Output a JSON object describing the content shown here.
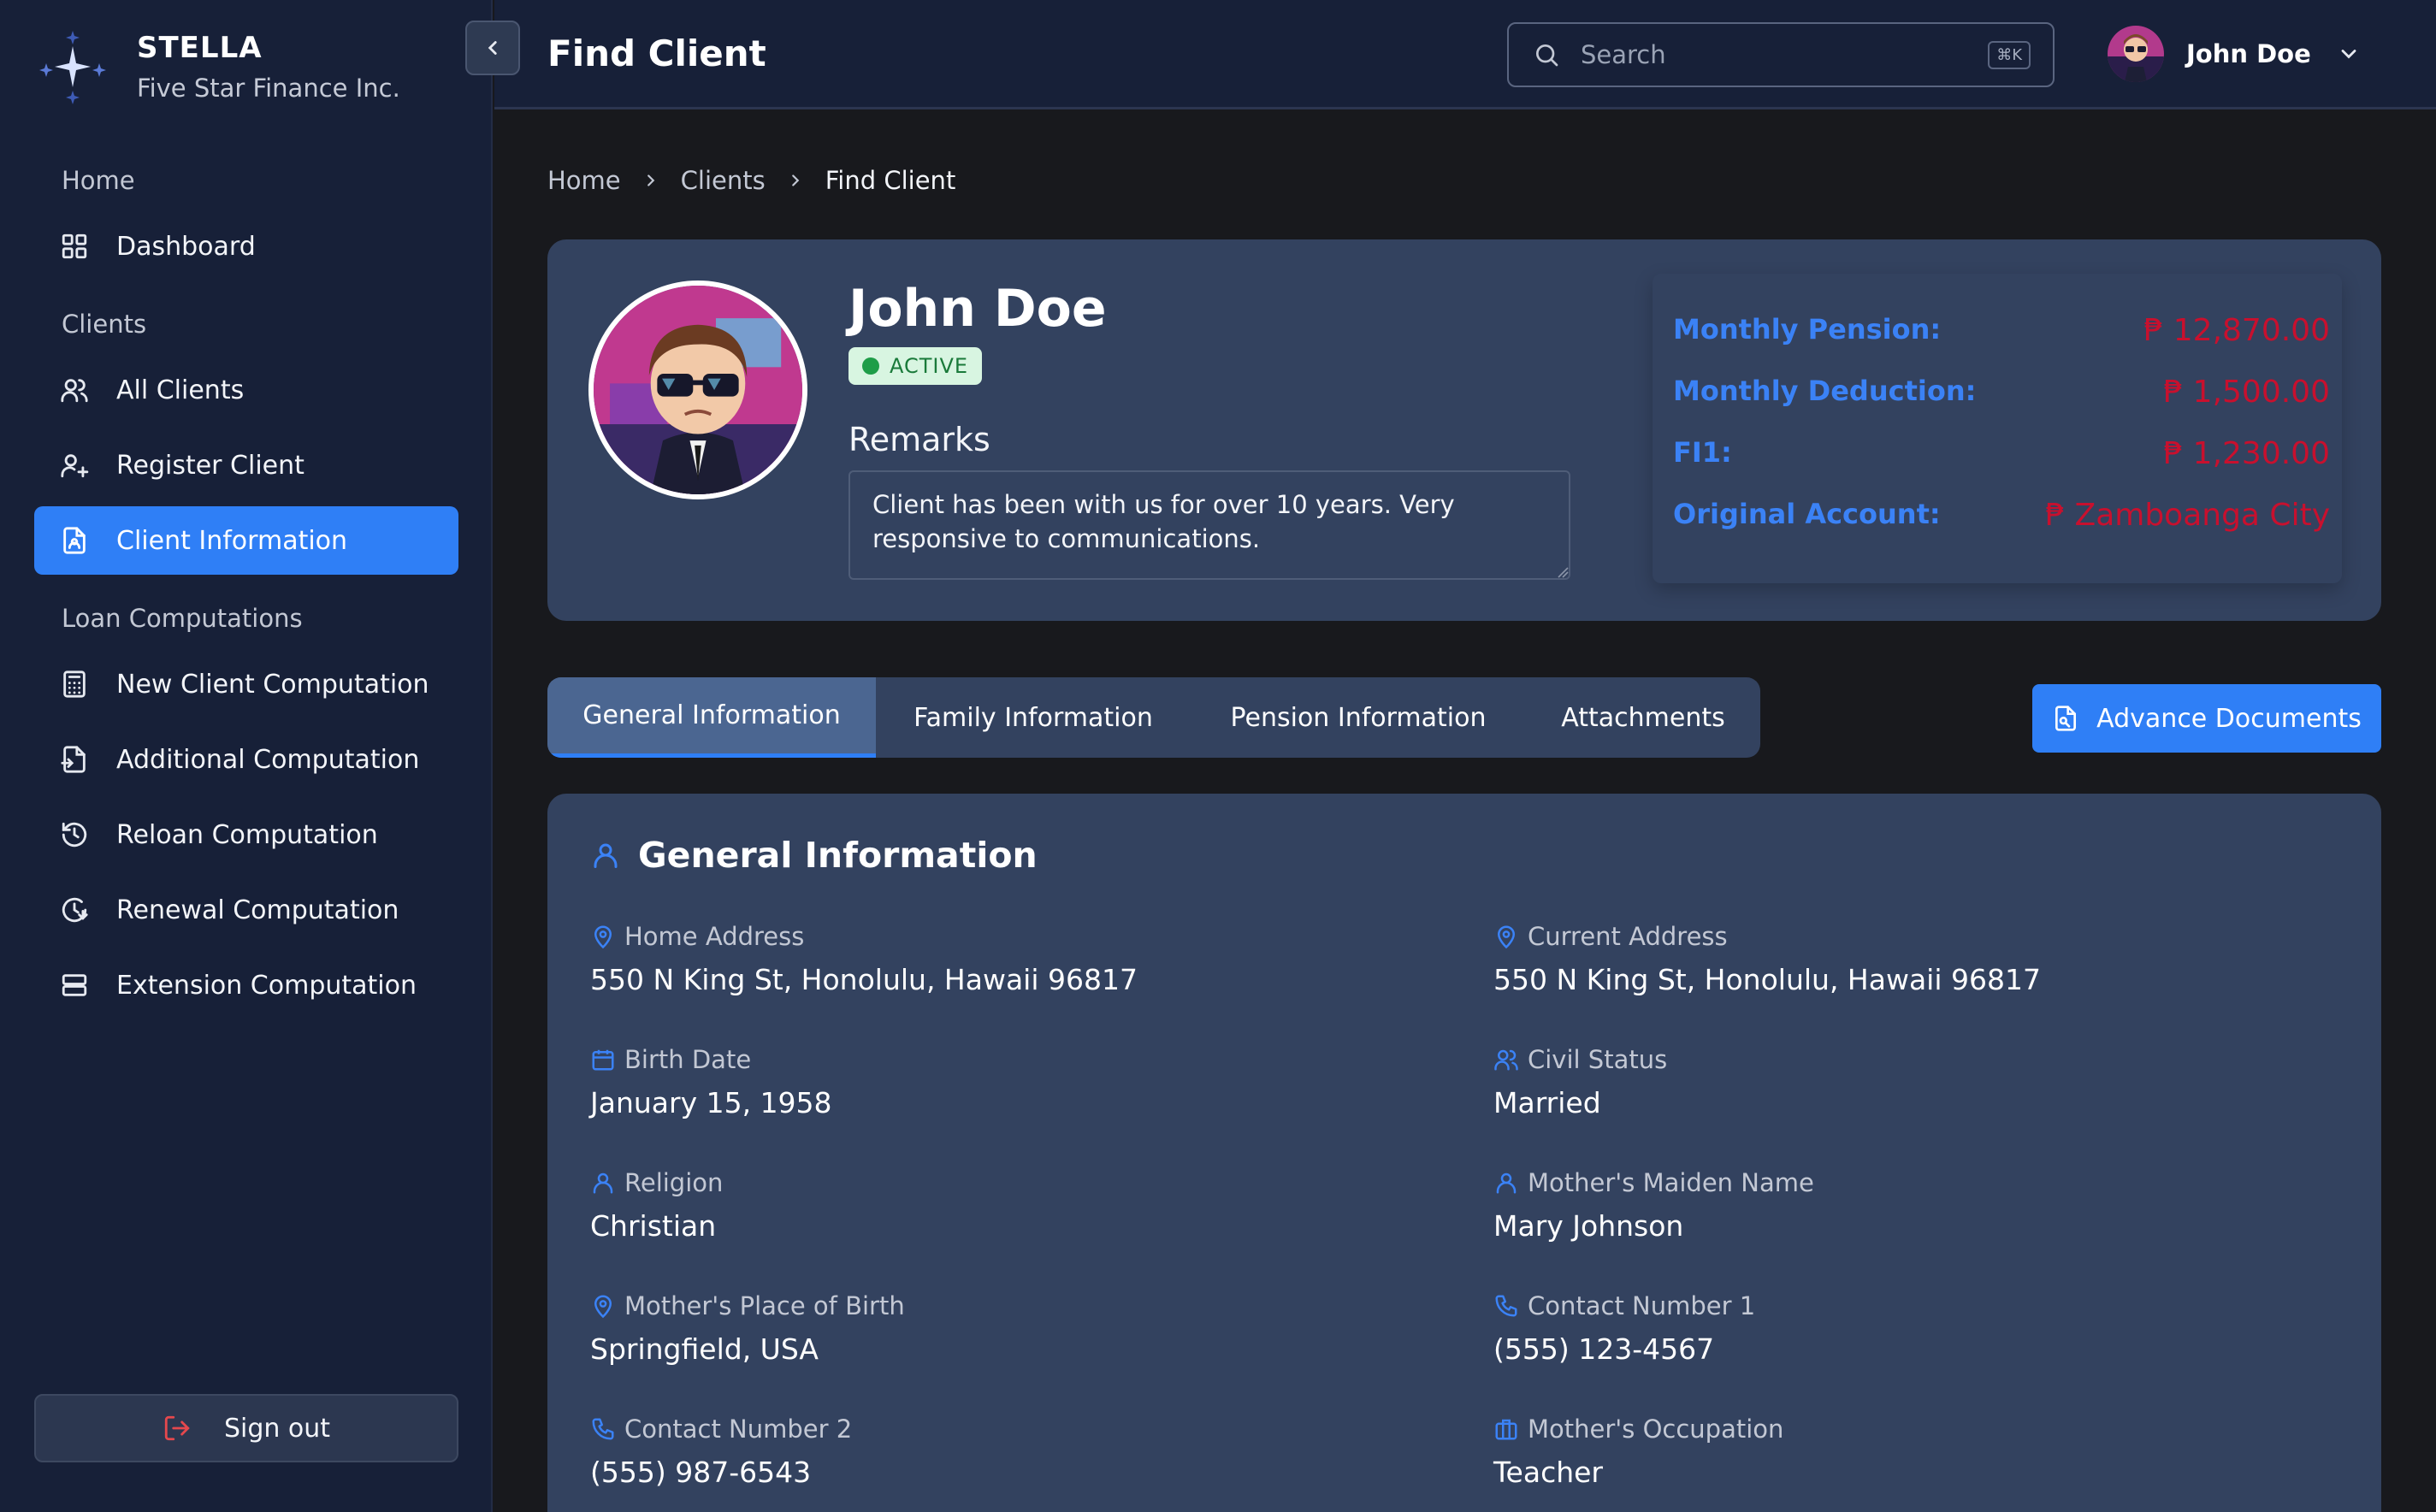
{
  "brand": {
    "name": "STELLA",
    "subtitle": "Five Star Finance Inc."
  },
  "sidebar": {
    "sections": [
      "Home",
      "Clients",
      "Loan Computations"
    ],
    "items": [
      {
        "label": "Dashboard",
        "icon": "dashboard-grid-icon"
      },
      {
        "label": "All Clients",
        "icon": "users-icon"
      },
      {
        "label": "Register Client",
        "icon": "user-plus-icon"
      },
      {
        "label": "Client Information",
        "icon": "document-user-icon",
        "active": true
      },
      {
        "label": "New Client Computation",
        "icon": "calculator-icon"
      },
      {
        "label": "Additional Computation",
        "icon": "document-arrow-icon"
      },
      {
        "label": "Reloan Computation",
        "icon": "history-icon"
      },
      {
        "label": "Renewal Computation",
        "icon": "clock-refresh-icon"
      },
      {
        "label": "Extension Computation",
        "icon": "layers-icon"
      }
    ],
    "signout_label": "Sign out"
  },
  "header": {
    "title": "Find Client",
    "search_placeholder": "Search",
    "search_shortcut": "⌘K",
    "user_name": "John Doe"
  },
  "breadcrumb": [
    "Home",
    "Clients",
    "Find Client"
  ],
  "profile": {
    "name": "John Doe",
    "status": "ACTIVE",
    "remarks_label": "Remarks",
    "remarks": "Client has been with us for over 10 years. Very responsive to communications.",
    "pension": [
      {
        "label": "Monthly Pension:",
        "value": "₱ 12,870.00"
      },
      {
        "label": "Monthly Deduction:",
        "value": "₱ 1,500.00"
      },
      {
        "label": "FI1:",
        "value": "₱ 1,230.00"
      },
      {
        "label": "Original Account:",
        "value": "₱ Zamboanga City"
      }
    ]
  },
  "tabs": [
    "General Information",
    "Family Information",
    "Pension Information",
    "Attachments"
  ],
  "advance_documents_label": "Advance Documents",
  "general_info": {
    "title": "General Information",
    "fields": [
      {
        "label": "Home Address",
        "value": "550 N King St, Honolulu, Hawaii 96817",
        "icon": "map-pin-icon"
      },
      {
        "label": "Current Address",
        "value": "550 N King St, Honolulu, Hawaii 96817",
        "icon": "map-pin-icon"
      },
      {
        "label": "Birth Date",
        "value": "January 15, 1958",
        "icon": "calendar-icon"
      },
      {
        "label": "Civil Status",
        "value": "Married",
        "icon": "users-icon"
      },
      {
        "label": "Religion",
        "value": "Christian",
        "icon": "user-icon"
      },
      {
        "label": "Mother's Maiden Name",
        "value": "Mary Johnson",
        "icon": "user-icon"
      },
      {
        "label": "Mother's Place of Birth",
        "value": "Springfield, USA",
        "icon": "map-pin-icon"
      },
      {
        "label": "Contact Number 1",
        "value": "(555) 123-4567",
        "icon": "phone-icon"
      },
      {
        "label": "Contact Number 2",
        "value": "(555) 987-6543",
        "icon": "phone-icon"
      },
      {
        "label": "Mother's Occupation",
        "value": "Teacher",
        "icon": "briefcase-icon"
      }
    ]
  },
  "colors": {
    "accent": "#2f7ff6",
    "sidebar_bg": "#172038",
    "card_bg": "#33425f",
    "label_blue": "#3b82f6",
    "value_red": "#c8102e",
    "status_green": "#1e9d48"
  }
}
